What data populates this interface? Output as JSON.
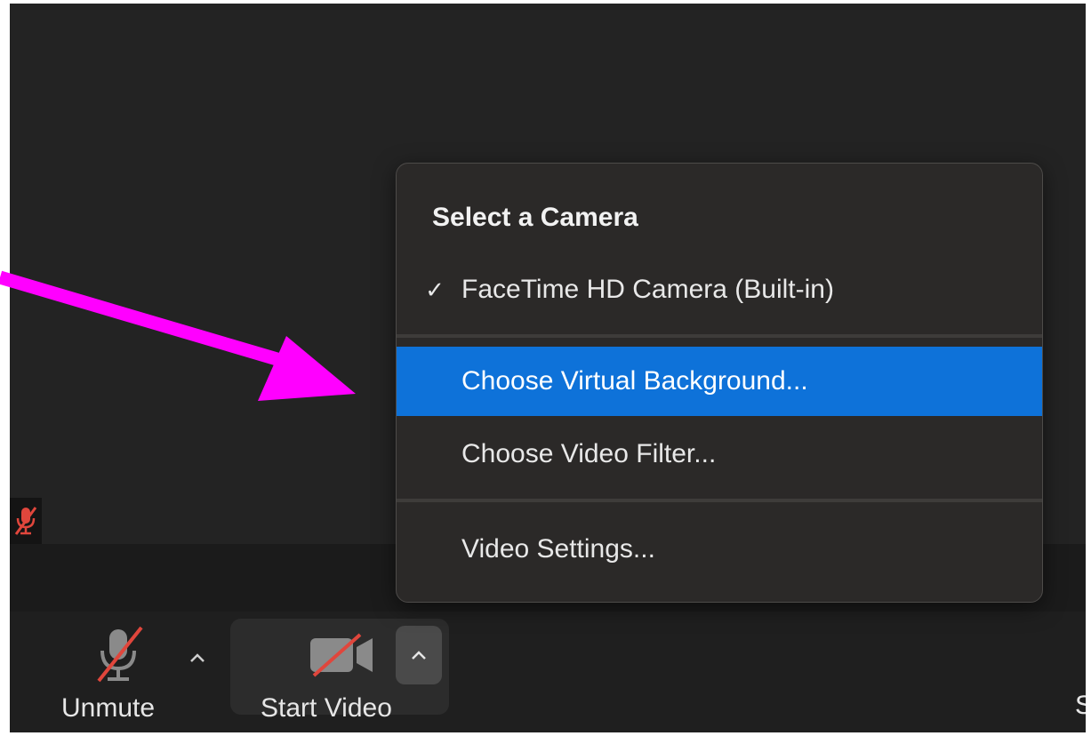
{
  "menu": {
    "header": "Select a Camera",
    "items": [
      {
        "label": "FaceTime HD Camera (Built-in)",
        "checked": true
      },
      {
        "label": "Choose Virtual Background...",
        "highlighted": true
      },
      {
        "label": "Choose Video Filter..."
      },
      {
        "label": "Video Settings..."
      }
    ],
    "checkmark_glyph": "✓",
    "highlight_color": "#0e72d9"
  },
  "toolbar": {
    "unmute_label": "Unmute",
    "start_video_label": "Start Video",
    "share_label_partial": "S"
  },
  "icons": {
    "mic": "microphone-muted-icon",
    "camera": "video-camera-off-icon",
    "caret": "chevron-up-icon",
    "muted_indicator": "mic-muted-icon"
  },
  "annotation": {
    "arrow_color": "#ff00ff"
  }
}
